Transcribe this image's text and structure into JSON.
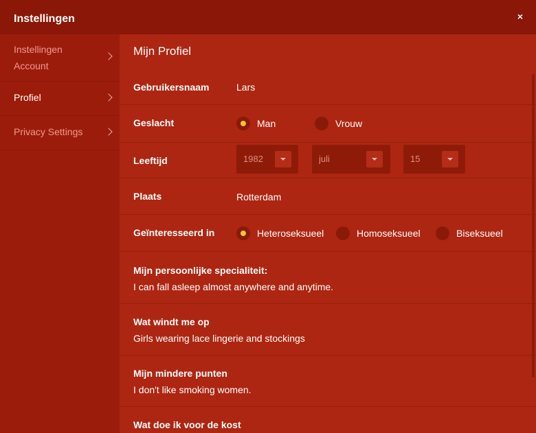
{
  "window": {
    "title": "Instellingen",
    "close_label": "×"
  },
  "sidebar": {
    "items": [
      {
        "label": "Instellingen Account"
      },
      {
        "label": "Profiel"
      },
      {
        "label": "Privacy Settings"
      }
    ]
  },
  "main": {
    "title": "Mijn Profiel",
    "username": {
      "label": "Gebruikersnaam",
      "value": "Lars"
    },
    "gender": {
      "label": "Geslacht",
      "options": [
        "Man",
        "Vrouw"
      ],
      "selected": "Man"
    },
    "age": {
      "label": "Leeftijd",
      "year": "1982",
      "month": "juli",
      "day": "15"
    },
    "place": {
      "label": "Plaats",
      "value": "Rotterdam"
    },
    "interested": {
      "label": "Geïnteresseerd in",
      "options": [
        "Heteroseksueel",
        "Homoseksueel",
        "Biseksueel"
      ],
      "selected": "Heteroseksueel"
    },
    "fields": [
      {
        "label": "Mijn persoonlijke specialiteit:",
        "value": "I can fall asleep almost anywhere and anytime."
      },
      {
        "label": "Wat windt me op",
        "value": "Girls wearing lace lingerie and stockings"
      },
      {
        "label": "Mijn mindere punten",
        "value": "I don't like smoking women."
      },
      {
        "label": "Wat doe ik voor de kost",
        "value": ""
      }
    ]
  },
  "colors": {
    "accent": "#f3c533",
    "header": "#8a1707",
    "sidebar": "#9c1c0b",
    "main": "#ad2612"
  }
}
